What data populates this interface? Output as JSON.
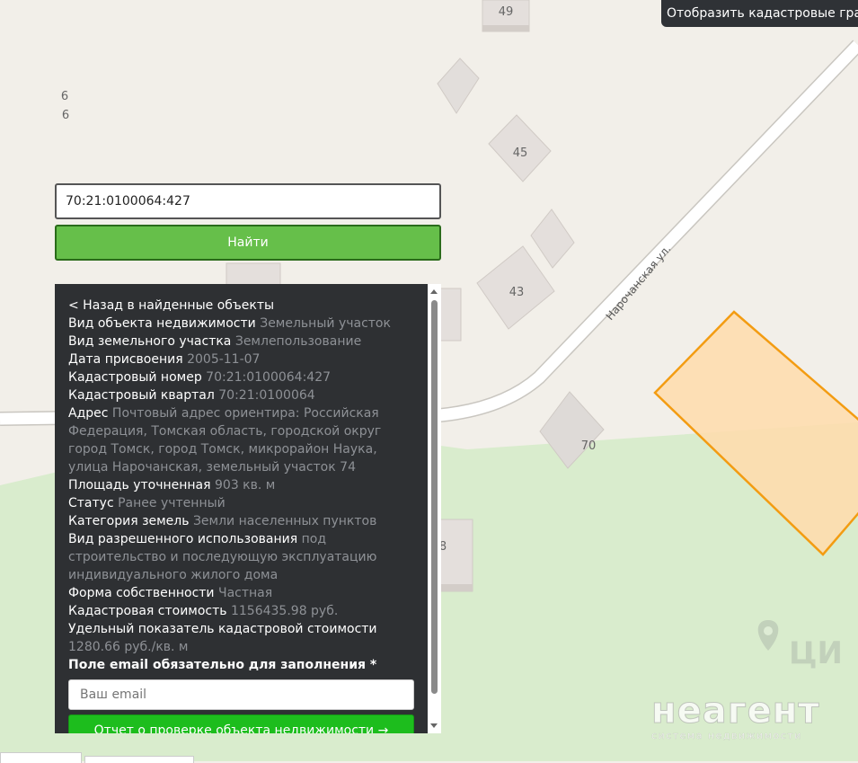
{
  "map": {
    "labels": {
      "house_49": "49",
      "house_45": "45",
      "house_43": "43",
      "house_70": "70",
      "house_8": "8",
      "house_6a": "6",
      "house_6b": "6"
    },
    "street": "Нарочанская ул.",
    "colors": {
      "background": "#f2efe9",
      "green_area": "#d9eccd",
      "parcel_fill": "#ffdcab",
      "parcel_stroke": "#f39c12",
      "building": "#e4dfdc"
    }
  },
  "cadastral_toggle": {
    "label": "Отобразить кадастровые границы",
    "icon": "refresh-icon"
  },
  "search": {
    "value": "70:21:0100064:427",
    "button_label": "Найти"
  },
  "info": {
    "back_label": "< Назад в найденные объекты",
    "rows": [
      {
        "label": "Вид объекта недвижимости",
        "value": "Земельный участок"
      },
      {
        "label": "Вид земельного участка",
        "value": "Землепользование"
      },
      {
        "label": "Дата присвоения",
        "value": "2005-11-07"
      },
      {
        "label": "Кадастровый номер",
        "value": "70:21:0100064:427"
      },
      {
        "label": "Кадастровый квартал",
        "value": "70:21:0100064"
      },
      {
        "label": "Адрес",
        "value": "Почтовый адрес ориентира: Российская Федерация, Томская область, городской округ город Томск, город Томск, микрорайон Наука, улица Нарочанская, земельный участок 74"
      },
      {
        "label": "Площадь уточненная",
        "value": "903 кв. м"
      },
      {
        "label": "Статус",
        "value": "Ранее учтенный"
      },
      {
        "label": "Категория земель",
        "value": "Земли населенных пунктов"
      },
      {
        "label": "Вид разрешенного использования",
        "value": "под строительство и последующую эксплуатацию индивидуального жилого дома"
      },
      {
        "label": "Форма собственности",
        "value": "Частная"
      },
      {
        "label": "Кадастровая стоимость",
        "value": "1156435.98 руб."
      },
      {
        "label": "Удельный показатель кадастровой стоимости",
        "value": "1280.66 руб./кв. м"
      }
    ],
    "email_required": "Поле email обязательно для заполнения *",
    "email_placeholder": "Ваш email",
    "report_button": "Отчет о проверке объекта недвижимости →"
  },
  "watermark": {
    "brand": "неагент",
    "tagline": "система недвижимости",
    "logo": "cian-logo"
  }
}
